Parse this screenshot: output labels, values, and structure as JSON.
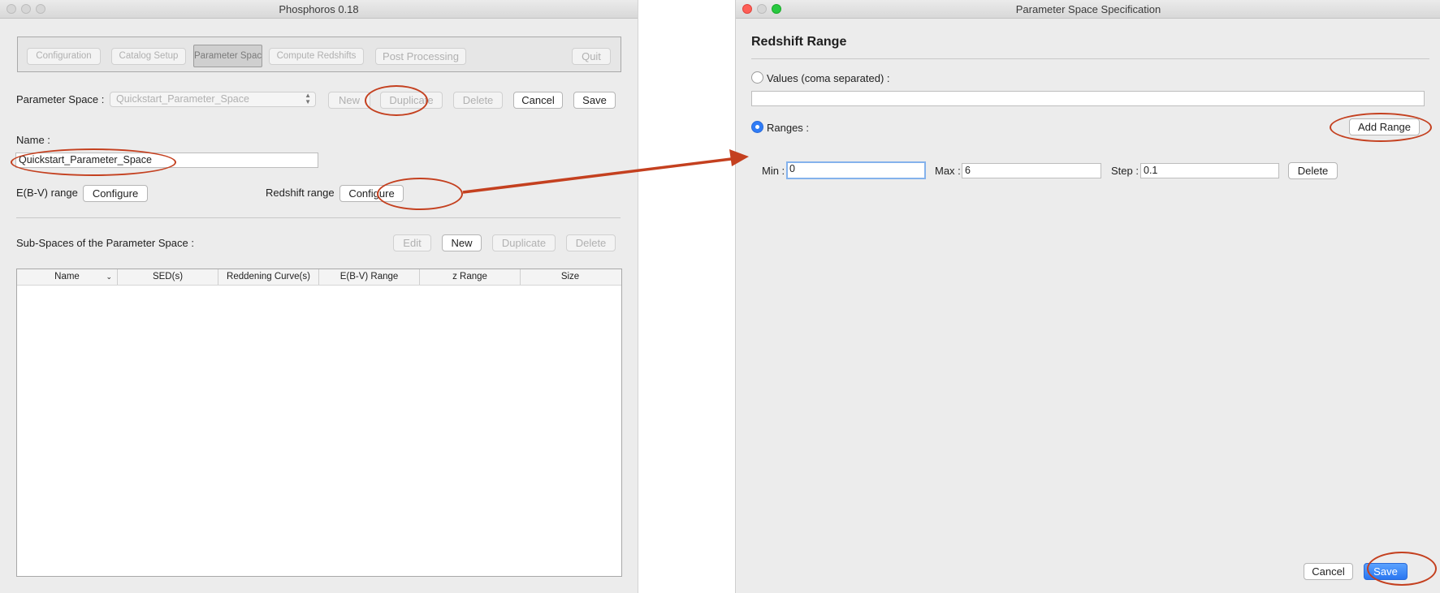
{
  "left_window": {
    "title": "Phosphoros 0.18",
    "toolbar": {
      "configuration": "Configuration",
      "catalog_setup": "Catalog Setup",
      "parameter_space": "Parameter Space",
      "compute_redshifts": "Compute Redshifts",
      "post_processing": "Post Processing",
      "quit": "Quit"
    },
    "parameter_space": {
      "label": "Parameter Space :",
      "selected": "Quickstart_Parameter_Space",
      "new": "New",
      "duplicate": "Duplicate",
      "delete": "Delete",
      "cancel": "Cancel",
      "save": "Save"
    },
    "name": {
      "label": "Name :",
      "value": "Quickstart_Parameter_Space"
    },
    "ebv": {
      "label": "E(B-V) range",
      "button": "Configure"
    },
    "redshift": {
      "label": "Redshift range",
      "button": "Configure"
    },
    "subspaces": {
      "label": "Sub-Spaces of the Parameter Space :",
      "edit": "Edit",
      "new": "New",
      "duplicate": "Duplicate",
      "delete": "Delete"
    },
    "table": {
      "columns": [
        "Name",
        "SED(s)",
        "Reddening Curve(s)",
        "E(B-V) Range",
        "z Range",
        "Size"
      ]
    }
  },
  "right_window": {
    "title": "Parameter Space Specification",
    "heading": "Redshift Range",
    "values_option": "Values (coma separated) :",
    "values_input": "",
    "ranges_option": "Ranges :",
    "add_range": "Add Range",
    "range": {
      "min_label": "Min :",
      "min_value": "0",
      "max_label": "Max :",
      "max_value": "6",
      "step_label": "Step :",
      "step_value": "0.1",
      "delete": "Delete"
    },
    "cancel": "Cancel",
    "save": "Save"
  },
  "colors": {
    "annotation": "#c4401f",
    "accent": "#2f7cf6",
    "window_bg": "#ececec"
  }
}
